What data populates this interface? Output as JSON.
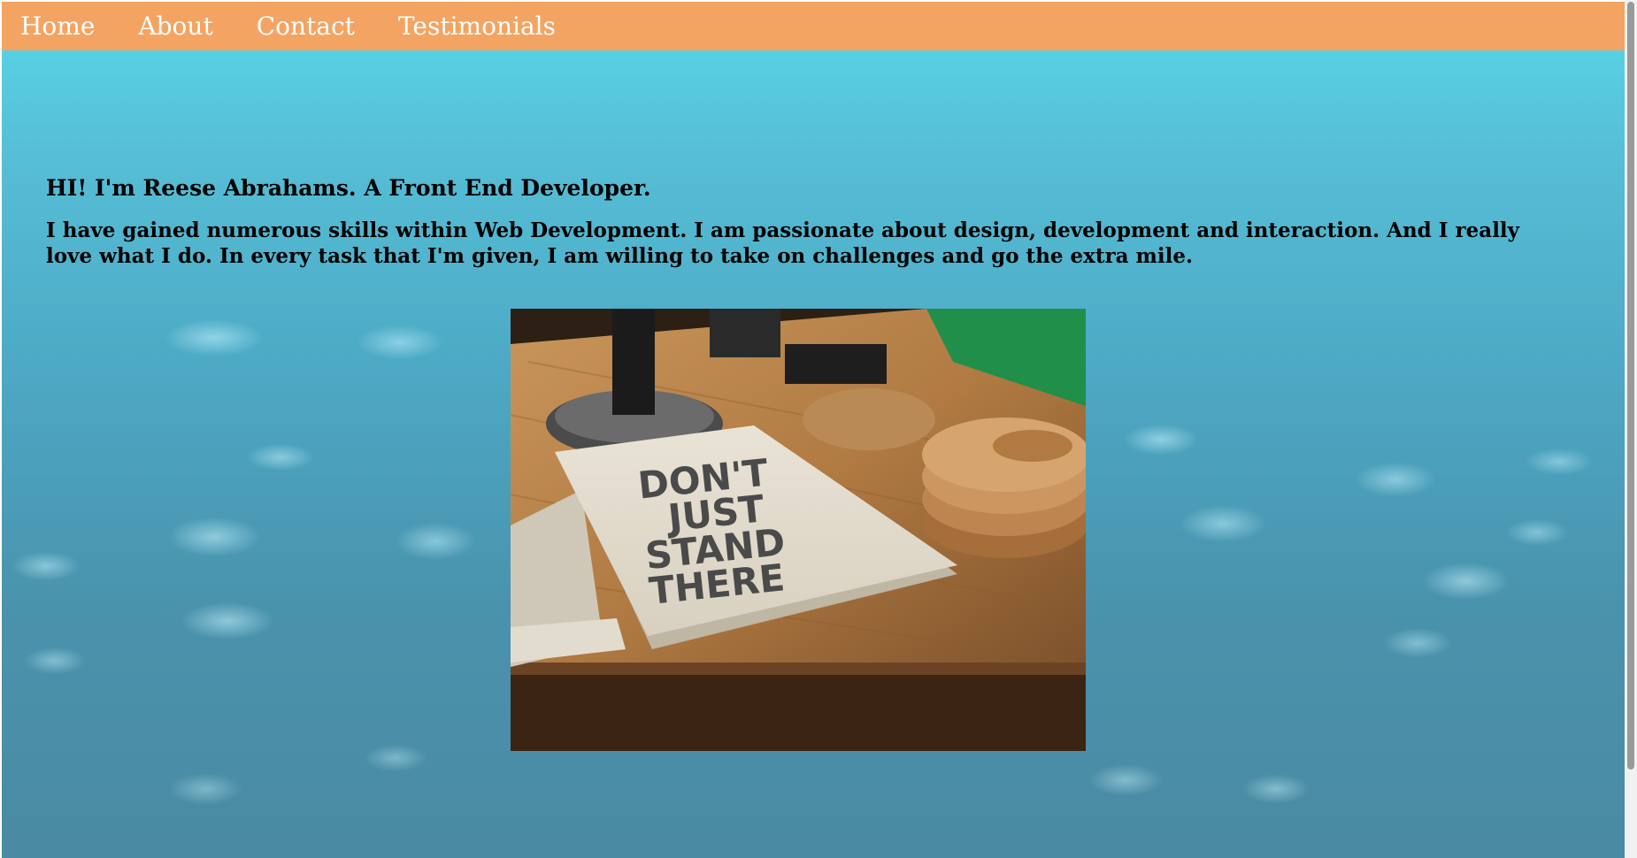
{
  "nav": {
    "items": [
      {
        "label": "Home"
      },
      {
        "label": "About"
      },
      {
        "label": "Contact"
      },
      {
        "label": "Testimonials"
      }
    ]
  },
  "hero": {
    "title": "HI! I'm Reese Abrahams. A Front End Developer.",
    "bio": "I have gained numerous skills within Web Development. I am passionate about design, development and interaction. And I really love what I do. In every task that I'm given, I am willing to take on challenges and go the extra mile."
  },
  "photo": {
    "sign_text": [
      "DON'T",
      "JUST",
      "STAND",
      "THERE"
    ]
  },
  "colors": {
    "navbar": "#f4a462",
    "nav_text": "#ffffff",
    "heading_text": "#000000",
    "background_top": "#59d7e8",
    "background_bottom": "#4a8aa2"
  }
}
